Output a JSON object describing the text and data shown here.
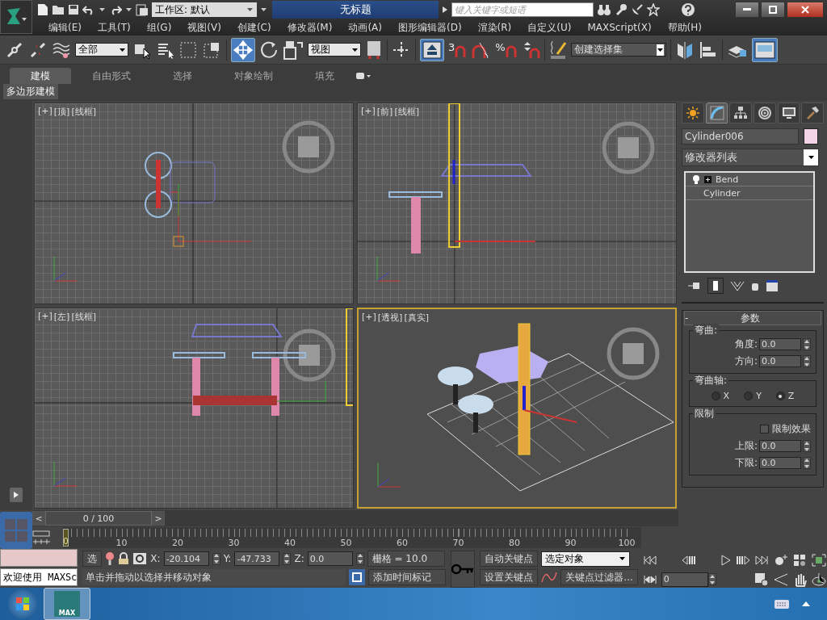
{
  "title_bar": {
    "workspace": "工作区: 默认",
    "title": "无标题",
    "search": {
      "placeholder": "键入关键字或短语"
    }
  },
  "menu": [
    "编辑(E)",
    "工具(T)",
    "组(G)",
    "视图(V)",
    "创建(C)",
    "修改器(M)",
    "动画(A)",
    "图形编辑器(D)",
    "渲染(R)",
    "自定义(U)",
    "MAXScript(X)",
    "帮助(H)"
  ],
  "toolbar": {
    "selection_filter": "全部",
    "reference_coordinate_system": "视图",
    "snap_label": "3",
    "percent_snap_label": "%",
    "named_selection_set": "创建选择集"
  },
  "ribbon": {
    "tabs": [
      {
        "label": "建模",
        "selected": true
      },
      {
        "label": "自由形式",
        "selected": false
      },
      {
        "label": "选择",
        "selected": false
      },
      {
        "label": "对象绘制",
        "selected": false
      },
      {
        "label": "填充",
        "selected": false
      }
    ],
    "panel_label": "多边形建模"
  },
  "viewports": [
    {
      "kind": "top",
      "active": false,
      "labels": [
        "[+]",
        "[顶]",
        "[线框]"
      ]
    },
    {
      "kind": "front",
      "active": false,
      "labels": [
        "[+]",
        "[前]",
        "[线框]"
      ]
    },
    {
      "kind": "left",
      "active": false,
      "labels": [
        "[+]",
        "[左]",
        "[线框]"
      ]
    },
    {
      "kind": "perspective",
      "active": true,
      "labels": [
        "[+]",
        "[透视]",
        "[真实]"
      ]
    }
  ],
  "command_panel": {
    "tabs": [
      {
        "kind": "create",
        "selected": false
      },
      {
        "kind": "modify",
        "selected": true
      },
      {
        "kind": "hierarchy",
        "selected": false
      },
      {
        "kind": "motion",
        "selected": false
      },
      {
        "kind": "display",
        "selected": false
      },
      {
        "kind": "utilities",
        "selected": false
      }
    ],
    "object_name": "Cylinder006",
    "modifier_list": "修改器列表",
    "stack": [
      {
        "kind": "modifier",
        "label": "Bend"
      },
      {
        "kind": "base",
        "label": "Cylinder"
      }
    ],
    "rollout": {
      "toggle": "-",
      "title": "参数",
      "bend_group": {
        "title": "弯曲:",
        "fields": [
          {
            "label": "角度:",
            "value": "0.0"
          },
          {
            "label": "方向:",
            "value": "0.0"
          }
        ]
      },
      "axis_group": {
        "title": "弯曲轴:",
        "options": [
          {
            "label": "X",
            "selected": false
          },
          {
            "label": "Y",
            "selected": false
          },
          {
            "label": "Z",
            "selected": true
          }
        ]
      },
      "limit_group": {
        "title": "限制",
        "checkbox": {
          "label": "限制效果",
          "checked": false
        },
        "fields": [
          {
            "label": "上限:",
            "value": "0.0"
          },
          {
            "label": "下限:",
            "value": "0.0"
          }
        ]
      }
    }
  },
  "time_slider": {
    "prev": "<",
    "position": "0 / 100",
    "next": ">"
  },
  "track_bar": {
    "current": "0",
    "ticks": [
      "10",
      "20",
      "30",
      "40",
      "50",
      "60",
      "70",
      "80",
      "90",
      "100"
    ]
  },
  "status": {
    "listener_output": "欢迎使用 MAXSc",
    "selection_button": "选",
    "coordinates": [
      {
        "label": "X:",
        "value": "-20.104"
      },
      {
        "label": "Y:",
        "value": "-47.733"
      },
      {
        "label": "Z:",
        "value": "0.0"
      }
    ],
    "grid": "栅格 = 10.0",
    "prompt": "单击并拖动以选择并移动对象",
    "time_tag": "添加时间标记",
    "auto_key": "自动关键点",
    "set_key": "设置关键点",
    "key_filter_set": "选定对象",
    "key_filters": "关键点过滤器...",
    "frame": "0"
  },
  "taskbar": {
    "app_label": "MAX"
  }
}
